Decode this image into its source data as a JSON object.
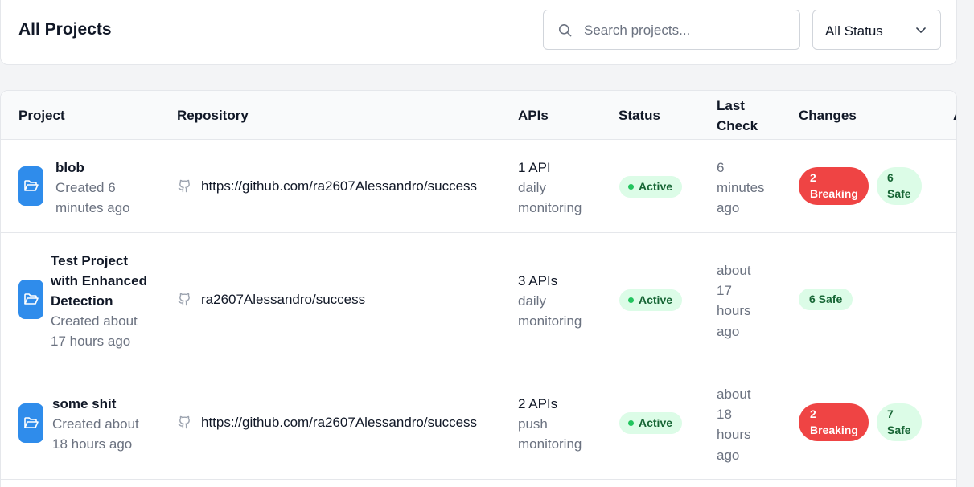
{
  "header": {
    "title": "All Projects",
    "search_placeholder": "Search projects...",
    "status_filter": "All Status"
  },
  "table": {
    "columns": {
      "project": "Project",
      "repository": "Repository",
      "apis": "APIs",
      "status": "Status",
      "last_check_1": "Last",
      "last_check_2": "Check",
      "changes": "Changes",
      "truncated": "A"
    },
    "rows": [
      {
        "name": "blob",
        "created_1": "Created 6",
        "created_2": "minutes ago",
        "repo": "https://github.com/ra2607Alessandro/success",
        "apis": "1 API",
        "mon_1": "daily",
        "mon_2": "monitoring",
        "status": "Active",
        "lc_1": "6",
        "lc_2": "minutes",
        "lc_3": "ago",
        "breaking_count": "2",
        "breaking_label": "Breaking",
        "safe_count": "6",
        "safe_label": "Safe"
      },
      {
        "name_1": "Test Project",
        "name_2": "with Enhanced",
        "name_3": "Detection",
        "created_1": "Created about",
        "created_2": "17 hours ago",
        "repo": "ra2607Alessandro/success",
        "apis": "3 APIs",
        "mon_1": "daily",
        "mon_2": "monitoring",
        "status": "Active",
        "lc_1": "about",
        "lc_2": "17",
        "lc_3": "hours",
        "lc_4": "ago",
        "safe": "6 Safe"
      },
      {
        "name": "some shit",
        "created_1": "Created about",
        "created_2": "18 hours ago",
        "repo": "https://github.com/ra2607Alessandro/success",
        "apis": "2 APIs",
        "mon_1": "push",
        "mon_2": "monitoring",
        "status": "Active",
        "lc_1": "about",
        "lc_2": "18",
        "lc_3": "hours",
        "lc_4": "ago",
        "breaking_count": "2",
        "breaking_label": "Breaking",
        "safe_count": "7",
        "safe_label": "Safe"
      }
    ]
  },
  "icons": {
    "search": "search-icon",
    "dropdown": "chevron-down-icon",
    "folder": "folder-open-icon",
    "repo": "github-icon"
  },
  "colors": {
    "folder_badge": "#2f8ceb",
    "active_bg": "#dcfce7",
    "breaking_bg": "#ef4444"
  }
}
